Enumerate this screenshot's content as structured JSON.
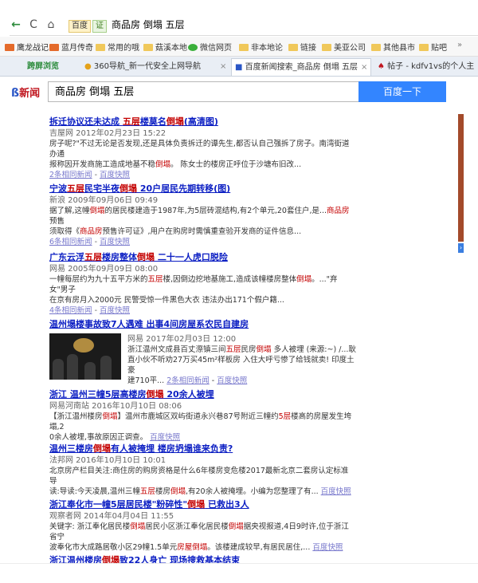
{
  "addressbar": {
    "back": "←",
    "refresh": "C",
    "home": "⌂",
    "badge": "百度",
    "badge2": "证",
    "url": "商品房 倒塌 五层"
  },
  "bookmarks": [
    {
      "label": "鹰龙战记"
    },
    {
      "label": "蓝月传奇"
    },
    {
      "label": "常用的哦"
    },
    {
      "label": "菇溪本地"
    },
    {
      "label": "微信网页"
    },
    {
      "label": "非本地论"
    },
    {
      "label": "链接"
    },
    {
      "label": "美亚公司"
    },
    {
      "label": "其他县市"
    },
    {
      "label": "贴吧"
    },
    {
      "label": "»"
    }
  ],
  "tabs": [
    {
      "label": "跨屏浏览"
    },
    {
      "label": "360导航_新一代安全上网导航"
    },
    {
      "label": "百度新闻搜索_商品房 倒塌 五层"
    },
    {
      "label": "帖子 - kdfv1vs的个人主"
    }
  ],
  "search": {
    "logo": "新闻",
    "query": "商品房 倒塌 五层",
    "button": "百度一下"
  },
  "results": [
    {
      "title_a": "拆迁协议还未达成 ",
      "title_hl1": "五层",
      "title_b": "楼莫名",
      "title_hl2": "倒塌",
      "title_c": "(高清图)",
      "source": "吉屋网  2012年02月23日 15:22",
      "body1": "房子呢?\"不过无论是否发现,还是具体负责拆迁的谭先生,都否认自己强拆了房子。南湾街道办通",
      "body2a": "报称因开发商施工造成地基不稳",
      "body2hl": "倒塌",
      "body2b": "。 陈女士的楼房正呼位于沙塘布旧改...",
      "link1": "2条相同新闻",
      "link2": "百度快照"
    },
    {
      "title_a": "宁波",
      "title_hl1": "五层",
      "title_b": "民宅半夜",
      "title_hl2": "倒塌",
      "title_c": " 20户居民先期转移(图)",
      "source": "新浪  2009年09月06日 09:49",
      "body1a": "据了解,这幢",
      "body1hl": "倒塌",
      "body1b": "的居民楼建造于1987年,为5层砖混结构,有2个单元,20套住户,是...",
      "body1hl2": "商品房",
      "body1c": "预售",
      "body2a": "须取得《",
      "body2hl": "商品房",
      "body2b": "预售许可证》,用户在购房时需慎重查验开发商的证件信息...",
      "link1": "6条相同新闻",
      "link2": "百度快照"
    },
    {
      "title_a": "广东云浮",
      "title_hl1": "五层",
      "title_b": "楼房整体",
      "title_hl2": "倒塌",
      "title_c": " 二十一人虎口脱险",
      "source": "网易  2005年09月09日 08:00",
      "body1a": "一幢每层约为九十五平方米的",
      "body1hl": "五层",
      "body1b": "楼,因倒边挖地基施工,造成该幢楼房整体",
      "body1hl2": "倒塌",
      "body1c": "。...\"弃女\"男子",
      "body2": "在京有房月入2000元 民警受惊一件黑色大衣 违法办出171个假户籍...",
      "link1": "4条相同新闻",
      "link2": "百度快照"
    },
    {
      "title": "温州塌楼事故致7人遇难 出事4间房屋系农民自建房",
      "source": "网易  2017年02月03日 12:00",
      "body1a": "浙江温州文成县百丈漈镇三间",
      "body1hl": "五层",
      "body1b": "民房",
      "body1hl2": "倒塌",
      "body1c": " 多人被埋 (来源:~) /...耿",
      "body2": "直小伙不听劝27万买45m²样板房 入住大呼亏惨了给钱就卖! 印度土豪",
      "body3": "建710平...",
      "link1": "2条相同新闻",
      "link2": "百度快照"
    },
    {
      "title_a": "浙江 温州三幢5层高楼房",
      "title_hl": "倒塌",
      "title_b": " 20余人被埋",
      "source": "网易河南站  2016年10月10日 08:06",
      "body1a": "【浙江温州楼房",
      "body1hl": "倒塌",
      "body1b": "】温州市鹿城区双屿街道永兴巷87号附近三幢约",
      "body1hl2": "5层",
      "body1c": "楼高的房屋发生垮塌,2",
      "body2": "0余人被埋,事故原因正调查。",
      "link2": "百度快照"
    },
    {
      "title_a": "温州三楼房",
      "title_hl": "倒塌",
      "title_b": "有人被掩埋 楼房坍塌谁来负责?",
      "source": "法邦网  2016年10月10日 10:01",
      "body1": "北京房产栏目关注:商住房的购房资格是什么6年楼房变危楼2017最新北京二套房认定标准导",
      "body2a": "读:导读:今天凌晨,温州三幢",
      "body2hl": "五层",
      "body2b": "楼房",
      "body2hl2": "倒塌",
      "body2c": ",有20余人被掩埋。小编为您整理了有...",
      "link2": "百度快照"
    },
    {
      "title_a": "浙江奉化市一幢5层居民楼\"粉碎性\"",
      "title_hl": "倒塌",
      "title_b": " 已救出3人",
      "source": "观察者网  2014年04月04日 11:55",
      "body1a": "关键字: 浙江奉化居民楼",
      "body1hl": "倒塌",
      "body1b": "居民小区浙江奉化居民楼",
      "body1hl2": "倒塌",
      "body1c": "据央视报道,4日9时许,位于浙江省宁",
      "body2a": "波奉化市大成路居敬小区29幢1.5单元",
      "body2hl": "房屋",
      "body2hl2": "倒塌",
      "body2b": "。该楼建成较早,有居民居住,...",
      "link2": "百度快照"
    },
    {
      "title_a": "浙江温州楼房",
      "title_hl": "倒塌",
      "title_b": "致22人身亡 现场搜救基本结束"
    }
  ]
}
